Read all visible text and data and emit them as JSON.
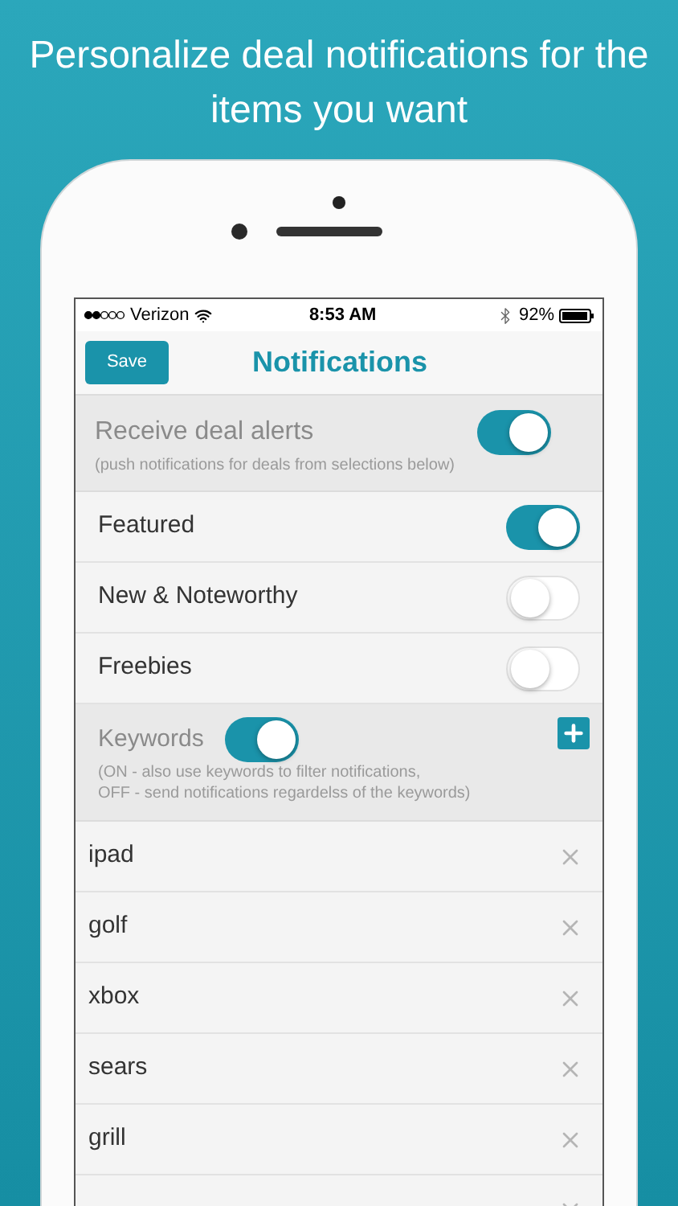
{
  "headline": "Personalize deal notifications for the items you want",
  "status_bar": {
    "carrier": "Verizon",
    "time": "8:53 AM",
    "battery": "92%"
  },
  "nav": {
    "save": "Save",
    "title": "Notifications"
  },
  "master": {
    "label": "Receive deal alerts",
    "note": "(push notifications for deals from selections below)",
    "on": true
  },
  "categories": [
    {
      "label": "Featured",
      "on": true
    },
    {
      "label": "New & Noteworthy",
      "on": false
    },
    {
      "label": "Freebies",
      "on": false
    }
  ],
  "keywords_section": {
    "label": "Keywords",
    "on": true,
    "note_lines": [
      "(ON - also use keywords to filter notifications,",
      "OFF - send notifications regardelss of the keywords)"
    ]
  },
  "keywords": [
    {
      "text": "ipad"
    },
    {
      "text": "golf"
    },
    {
      "text": "xbox"
    },
    {
      "text": "sears"
    },
    {
      "text": "grill"
    }
  ]
}
